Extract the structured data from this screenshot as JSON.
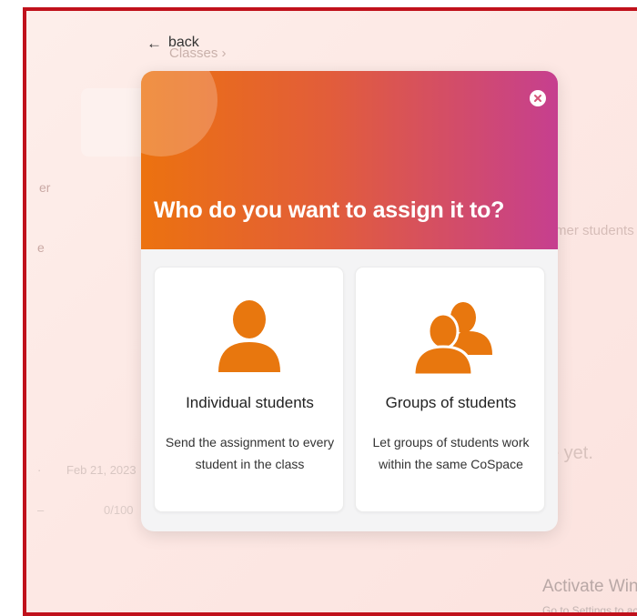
{
  "nav": {
    "back_label": "back"
  },
  "background": {
    "breadcrumb": "Classes  ›",
    "fragment_er": "er",
    "fragment_e": "e",
    "former_students": "rmer students",
    "empty_text": "e yet.",
    "date": "Feb 21, 2023",
    "score": "0/100",
    "activate_title": "Activate Windows",
    "activate_sub": "Go to Settings to activate Windows."
  },
  "modal": {
    "title": "Who do you want to assign it to?",
    "header_icon": "question-mark-icon",
    "close_icon": "close-icon",
    "options": [
      {
        "title": "Individual students",
        "description": "Send the assignment to every student in the class",
        "icon": "person-icon"
      },
      {
        "title": "Groups of students",
        "description": "Let groups of students work within the same CoSpace",
        "icon": "group-icon"
      }
    ]
  },
  "colors": {
    "accent_orange": "#ec720f",
    "header_gradient_end": "#c63f8f",
    "frame_border": "#c0111b",
    "icon_orange": "#e8770e"
  }
}
